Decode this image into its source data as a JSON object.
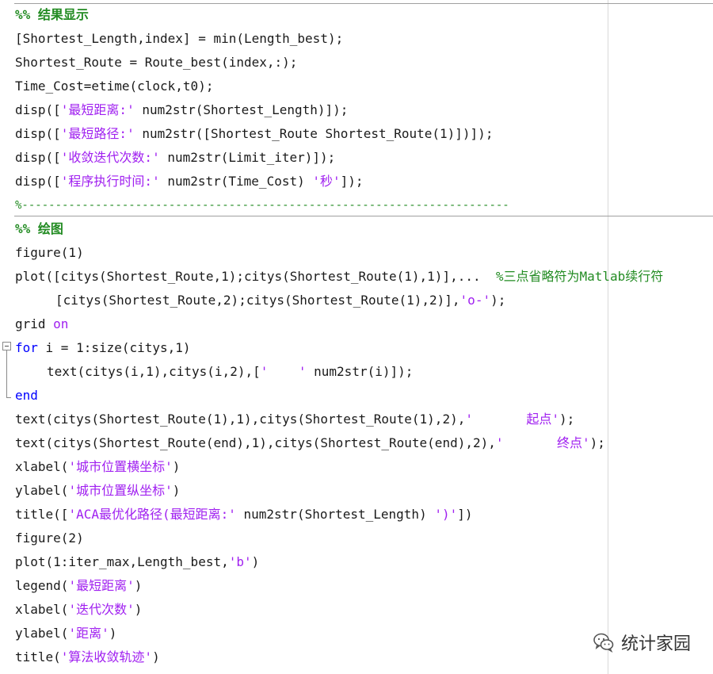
{
  "editor": {
    "section1": {
      "header": "%% 结果显示",
      "l1": "[Shortest_Length,index] = min(Length_best);",
      "l2": "Shortest_Route = Route_best(index,:);",
      "l3": "Time_Cost=etime(clock,t0);",
      "l4_pre": "disp([",
      "l4_str": "'最短距离:'",
      "l4_post": " num2str(Shortest_Length)]);",
      "l5_pre": "disp([",
      "l5_str": "'最短路径:'",
      "l5_post": " num2str([Shortest_Route Shortest_Route(1)])]);",
      "l6_pre": "disp([",
      "l6_str": "'收敛迭代次数:'",
      "l6_post": " num2str(Limit_iter)]);",
      "l7_pre": "disp([",
      "l7_str1": "'程序执行时间:'",
      "l7_mid": " num2str(Time_Cost) ",
      "l7_str2": "'秒'",
      "l7_post": "]);",
      "separator": "%-------------------------------------------------------------------------"
    },
    "section2": {
      "header": "%% 绘图",
      "l1": "figure(1)",
      "l2_code": "plot([citys(Shortest_Route,1);citys(Shortest_Route(1),1)],...  ",
      "l2_comment": "%三点省略符为Matlab续行符",
      "l3_pre": "[citys(Shortest_Route,2);citys(Shortest_Route(1),2)],",
      "l3_str": "'o-'",
      "l3_post": ");",
      "l4_pre": "grid ",
      "l4_kw": "on",
      "l5_kw": "for",
      "l5_post": " i = 1:size(citys,1)",
      "l6_pre": "text(citys(i,1),citys(i,2),[",
      "l6_str": "'    '",
      "l6_post": " num2str(i)]);",
      "l7_kw": "end",
      "l8_pre": "text(citys(Shortest_Route(1),1),citys(Shortest_Route(1),2),",
      "l8_str": "'       起点'",
      "l8_post": ");",
      "l9_pre": "text(citys(Shortest_Route(end),1),citys(Shortest_Route(end),2),",
      "l9_str": "'       终点'",
      "l9_post": ");",
      "l10_pre": "xlabel(",
      "l10_str": "'城市位置横坐标'",
      "l10_post": ")",
      "l11_pre": "ylabel(",
      "l11_str": "'城市位置纵坐标'",
      "l11_post": ")",
      "l12_pre": "title([",
      "l12_str1": "'ACA最优化路径(最短距离:'",
      "l12_mid": " num2str(Shortest_Length) ",
      "l12_str2": "')'",
      "l12_post": "])",
      "l13": "figure(2)",
      "l14_pre": "plot(1:iter_max,Length_best,",
      "l14_str": "'b'",
      "l14_post": ")",
      "l15_pre": "legend(",
      "l15_str": "'最短距离'",
      "l15_post": ")",
      "l16_pre": "xlabel(",
      "l16_str": "'迭代次数'",
      "l16_post": ")",
      "l17_pre": "ylabel(",
      "l17_str": "'距离'",
      "l17_post": ")",
      "l18_pre": "title(",
      "l18_str": "'算法收敛轨迹'",
      "l18_post": ")"
    }
  },
  "watermark": {
    "icon": "wechat-icon",
    "text": "统计家园"
  },
  "colors": {
    "keyword": "#0000ff",
    "string": "#a020f0",
    "comment": "#228b22"
  }
}
